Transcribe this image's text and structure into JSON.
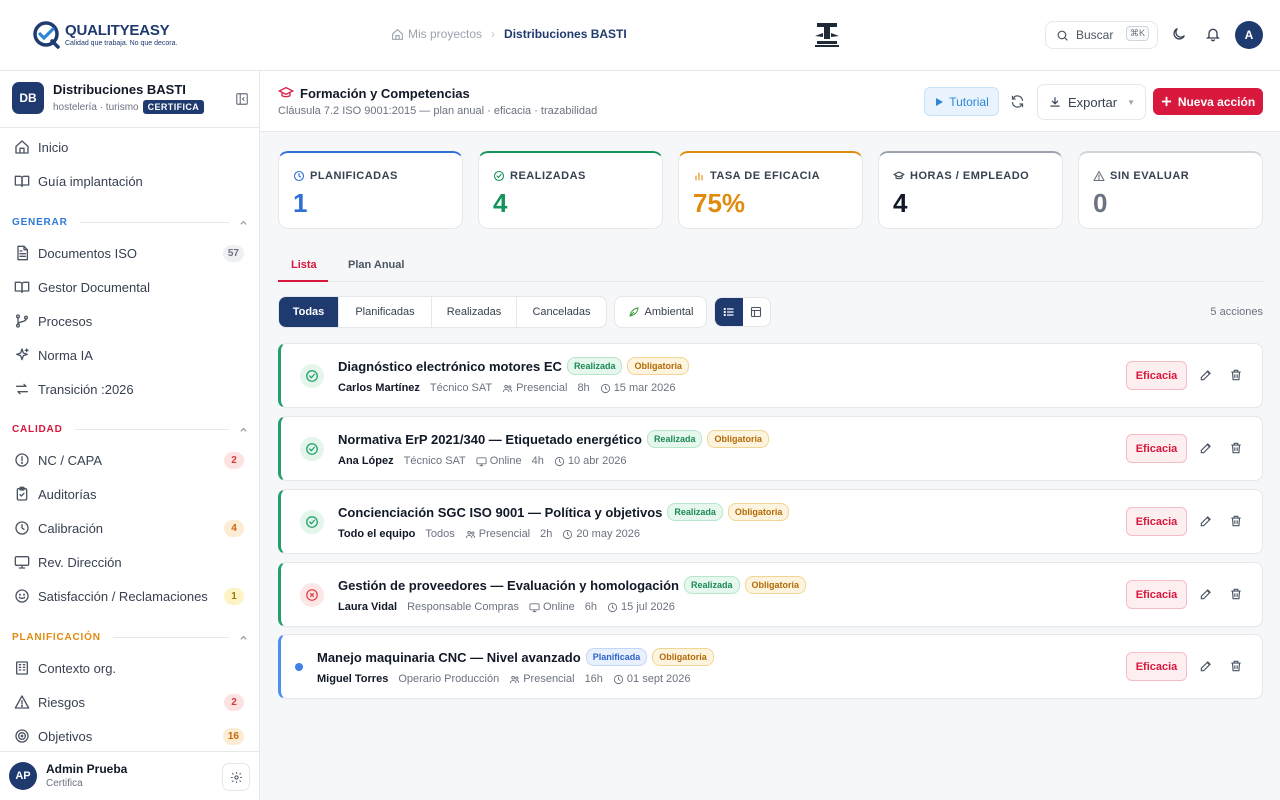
{
  "header": {
    "logo_name": "QUALITYEASY",
    "logo_tagline": "Calidad que trabaja. No que decora.",
    "breadcrumb_home": "Mis proyectos",
    "breadcrumb_current": "Distribuciones BASTI",
    "search_label": "Buscar",
    "search_shortcut": "⌘K",
    "avatar_initial": "A"
  },
  "sidebar": {
    "workspace": {
      "initials": "DB",
      "name": "Distribuciones BASTI",
      "sector": "hostelería · turismo",
      "tag": "CERTIFICA"
    },
    "top_items": [
      {
        "label": "Inicio",
        "icon": "home-icon"
      },
      {
        "label": "Guía implantación",
        "icon": "book-icon"
      }
    ],
    "sections": [
      {
        "title": "GENERAR",
        "color": "#2f7ad6",
        "items": [
          {
            "label": "Documentos ISO",
            "icon": "file-icon",
            "count": "57"
          },
          {
            "label": "Gestor Documental",
            "icon": "book-icon"
          },
          {
            "label": "Procesos",
            "icon": "branch-icon"
          },
          {
            "label": "Norma IA",
            "icon": "sparkles-icon"
          },
          {
            "label": "Transición :2026",
            "icon": "arrows-icon"
          }
        ]
      },
      {
        "title": "CALIDAD",
        "color": "#d8183c",
        "items": [
          {
            "label": "NC / CAPA",
            "icon": "alert-circle-icon",
            "count": "2"
          },
          {
            "label": "Auditorías",
            "icon": "clipboard-icon"
          },
          {
            "label": "Calibración",
            "icon": "clock-icon",
            "count": "4"
          },
          {
            "label": "Rev. Dirección",
            "icon": "monitor-icon"
          },
          {
            "label": "Satisfacción / Reclamaciones",
            "icon": "smile-icon",
            "count": "1"
          }
        ]
      },
      {
        "title": "PLANIFICACIÓN",
        "color": "#e08a0e",
        "items": [
          {
            "label": "Contexto org.",
            "icon": "building-icon"
          },
          {
            "label": "Riesgos",
            "icon": "warning-icon",
            "count": "2"
          },
          {
            "label": "Objetivos",
            "icon": "target-icon",
            "count": "16"
          }
        ]
      }
    ],
    "user": {
      "initials": "AP",
      "name": "Admin Prueba",
      "role": "Certifica"
    }
  },
  "page": {
    "title": "Formación y Competencias",
    "subtitle": "Cláusula 7.2 ISO 9001:2015 — plan anual · eficacia · trazabilidad",
    "tutorial_label": "Tutorial",
    "export_label": "Exportar",
    "new_action_label": "Nueva acción"
  },
  "stats": [
    {
      "label": "PLANIFICADAS",
      "value": "1",
      "color": "#2f6fd6",
      "icon": "clock-icon"
    },
    {
      "label": "REALIZADAS",
      "value": "4",
      "color": "#15935c",
      "icon": "check-circle-icon"
    },
    {
      "label": "TASA DE EFICACIA",
      "value": "75%",
      "color": "#e08a0e",
      "icon": "bar-chart-icon"
    },
    {
      "label": "HORAS / EMPLEADO",
      "value": "4",
      "color": "#111827",
      "icon": "graduation-cap-icon"
    },
    {
      "label": "SIN EVALUAR",
      "value": "0",
      "color": "#6b7280",
      "icon": "warning-icon"
    }
  ],
  "tabs": [
    "Lista",
    "Plan Anual"
  ],
  "filters": [
    "Todas",
    "Planificadas",
    "Realizadas",
    "Canceladas"
  ],
  "ambiental_label": "Ambiental",
  "count_label": "5 acciones",
  "rows": [
    {
      "title": "Diagnóstico electrónico motores EC",
      "status": "Realizada",
      "mandatory": "Obligatoria",
      "who": "Carlos Martínez",
      "role": "Técnico SAT",
      "mode": "Presencial",
      "hours": "8h",
      "date": "15 mar 2026",
      "icon_state": "ok"
    },
    {
      "title": "Normativa ErP 2021/340 — Etiquetado energético",
      "status": "Realizada",
      "mandatory": "Obligatoria",
      "who": "Ana López",
      "role": "Técnico SAT",
      "mode": "Online",
      "hours": "4h",
      "date": "10 abr 2026",
      "icon_state": "ok"
    },
    {
      "title": "Concienciación SGC ISO 9001 — Política y objetivos",
      "status": "Realizada",
      "mandatory": "Obligatoria",
      "who": "Todo el equipo",
      "role": "Todos",
      "mode": "Presencial",
      "hours": "2h",
      "date": "20 may 2026",
      "icon_state": "ok"
    },
    {
      "title": "Gestión de proveedores — Evaluación y homologación",
      "status": "Realizada",
      "mandatory": "Obligatoria",
      "who": "Laura Vidal",
      "role": "Responsable Compras",
      "mode": "Online",
      "hours": "6h",
      "date": "15 jul 2026",
      "icon_state": "ko"
    },
    {
      "title": "Manejo maquinaria CNC — Nivel avanzado",
      "status": "Planificada",
      "mandatory": "Obligatoria",
      "who": "Miguel Torres",
      "role": "Operario Producción",
      "mode": "Presencial",
      "hours": "16h",
      "date": "01 sept 2026",
      "icon_state": "planned"
    }
  ],
  "row_action_label": "Eficacia"
}
